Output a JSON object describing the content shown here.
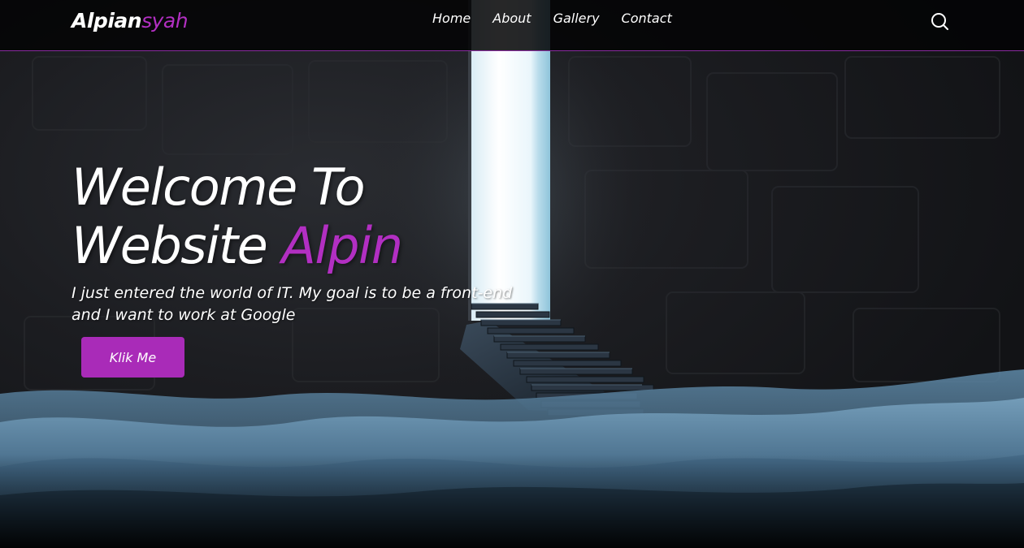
{
  "brand": {
    "name_main": "Alpian",
    "name_accent": "syah"
  },
  "nav": {
    "items": [
      {
        "label": "Home"
      },
      {
        "label": "About"
      },
      {
        "label": "Gallery"
      },
      {
        "label": "Contact"
      }
    ],
    "search_icon": "search-icon"
  },
  "hero": {
    "title_line1": "Welcome To",
    "title_line2_main": "Website",
    "title_line2_accent": "Alpin",
    "description": "I just entered the world of IT. My goal is to be a front-end and I want to work at Google",
    "button_label": "Klik Me"
  },
  "theme": {
    "accent": "#b22fc2",
    "button_bg": "#a92bb8",
    "navbar_bg": "#050506",
    "text": "#ffffff"
  }
}
